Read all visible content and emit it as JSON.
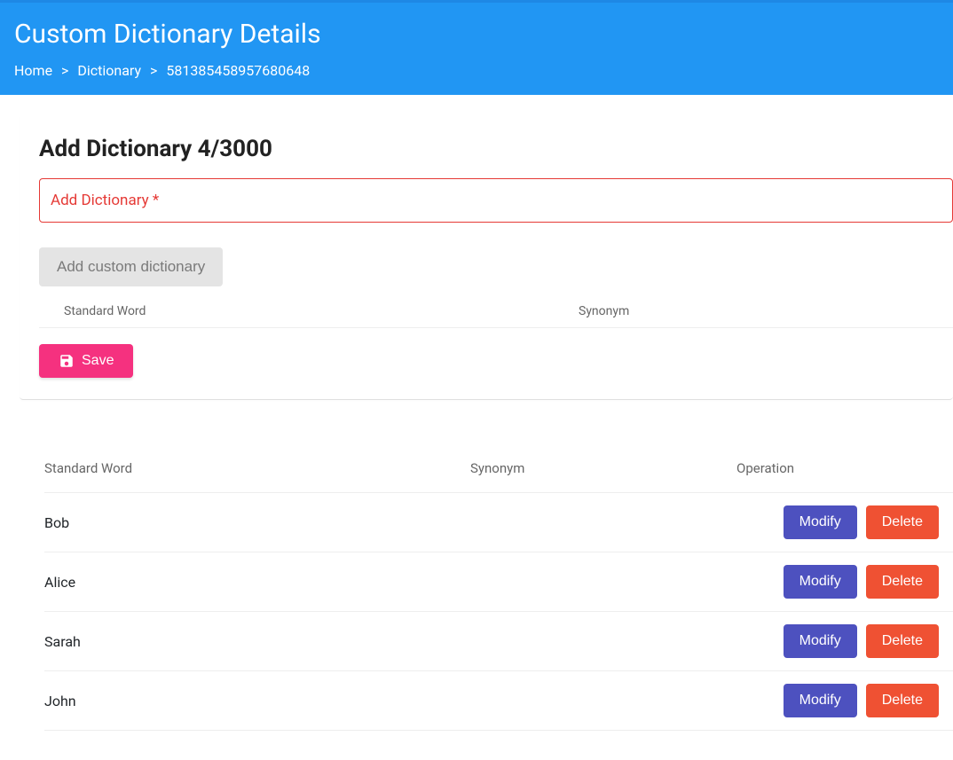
{
  "header": {
    "title": "Custom Dictionary Details",
    "breadcrumb": {
      "home": "Home",
      "dictionary": "Dictionary",
      "id": "581385458957680648"
    }
  },
  "addSection": {
    "heading": "Add Dictionary 4/3000",
    "inputPlaceholder": "Add Dictionary *",
    "addCustomBtn": "Add custom dictionary",
    "col_standard": "Standard Word",
    "col_synonym": "Synonym",
    "saveBtn": "Save"
  },
  "table": {
    "col_standard": "Standard Word",
    "col_synonym": "Synonym",
    "col_operation": "Operation",
    "modifyBtn": "Modify",
    "deleteBtn": "Delete",
    "rows": [
      {
        "standard": "Bob",
        "synonym": ""
      },
      {
        "standard": "Alice",
        "synonym": ""
      },
      {
        "standard": "Sarah",
        "synonym": ""
      },
      {
        "standard": "John",
        "synonym": ""
      }
    ]
  }
}
